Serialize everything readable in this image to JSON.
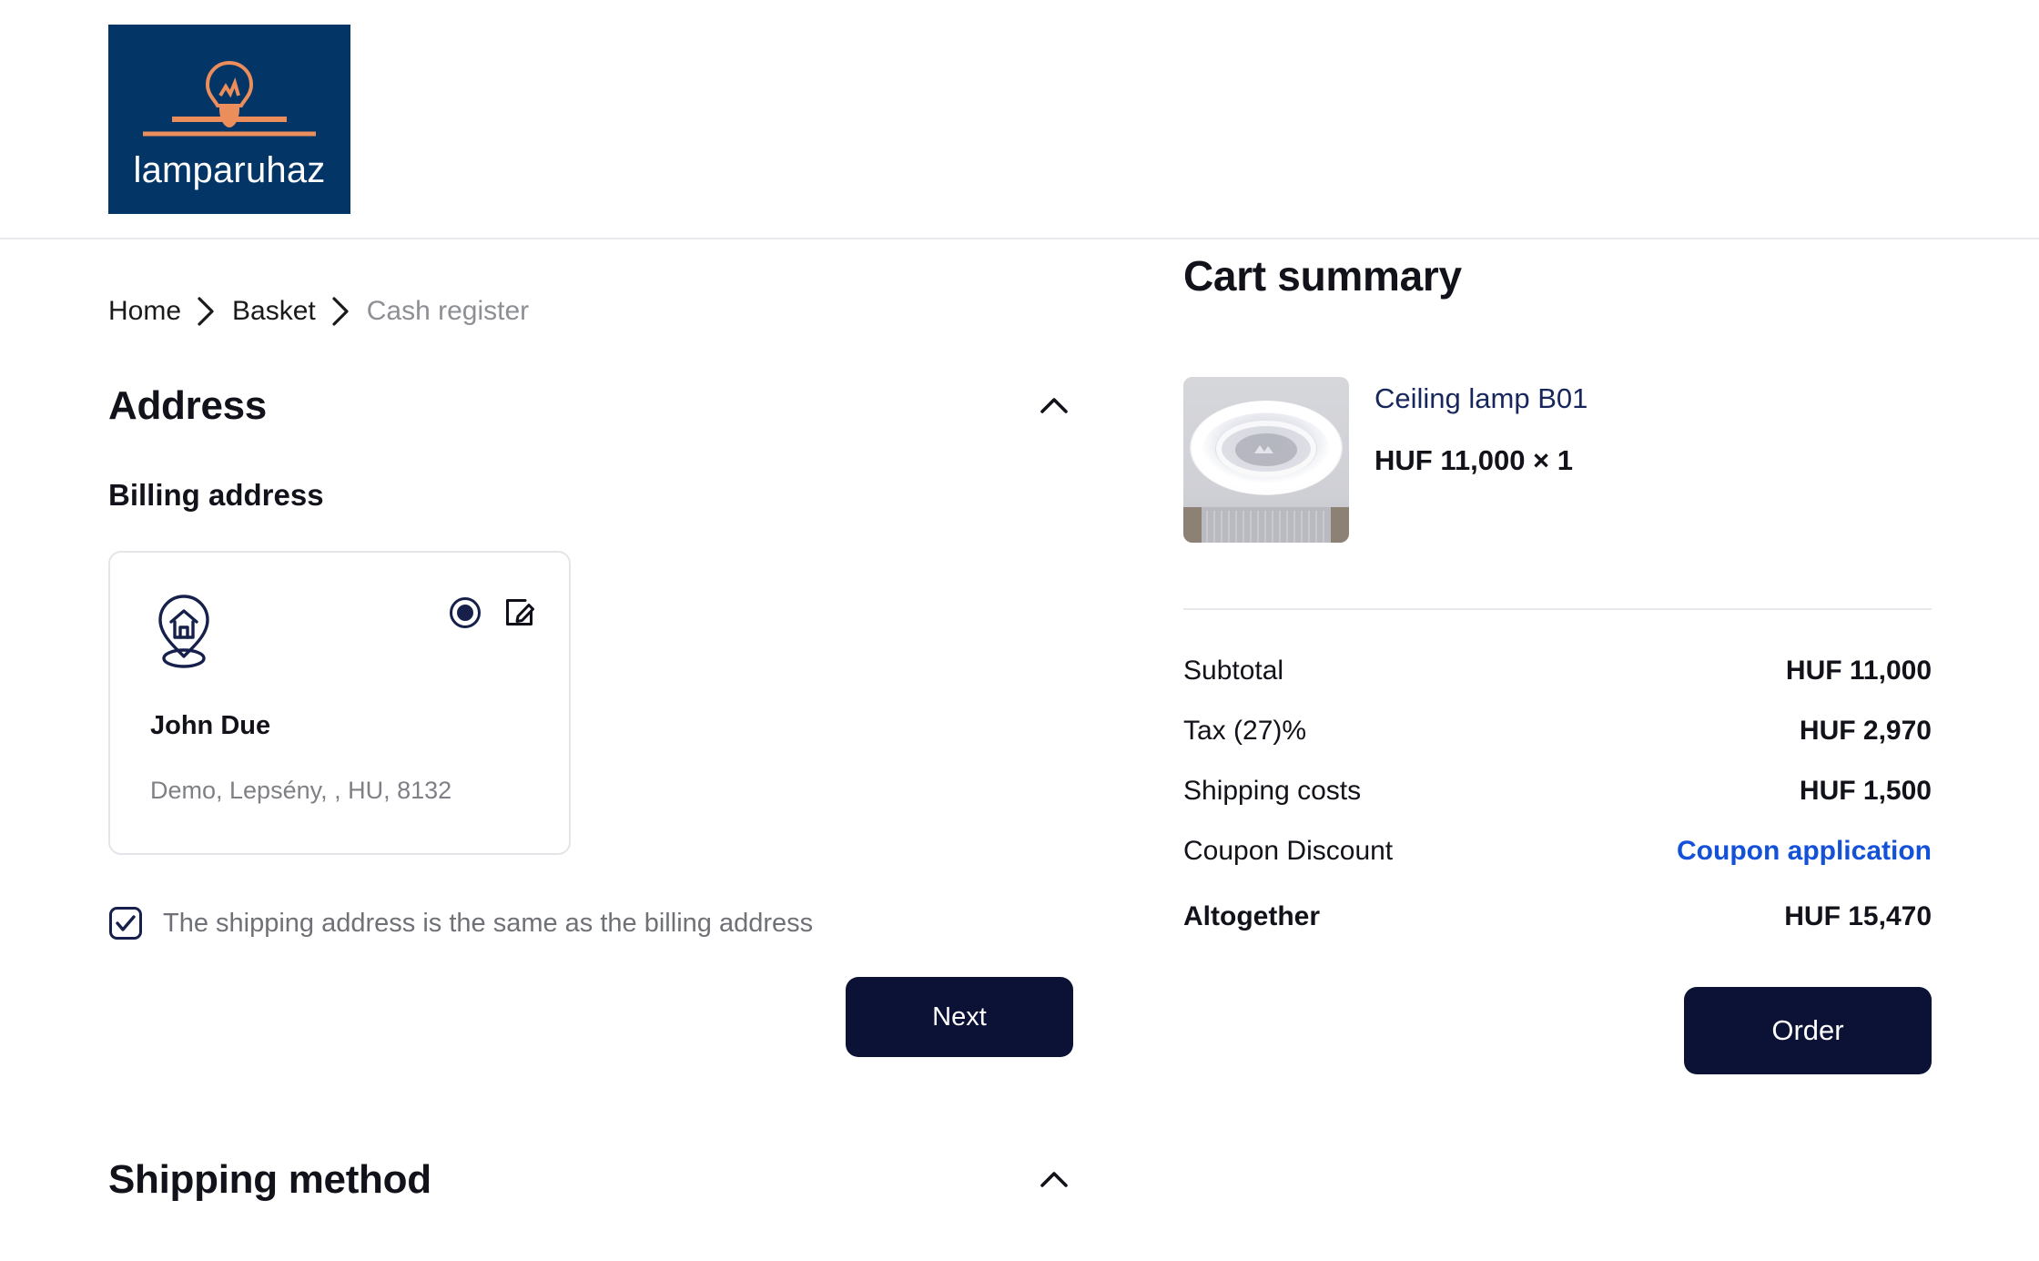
{
  "header": {
    "logo_word": "lamparuhaz",
    "logo_bg": "#033567",
    "logo_accent": "#ec8d5c"
  },
  "breadcrumb": {
    "items": [
      {
        "label": "Home",
        "muted": false
      },
      {
        "label": "Basket",
        "muted": false
      },
      {
        "label": "Cash register",
        "muted": true
      }
    ],
    "separator_icon": "chevron-right-icon"
  },
  "address_section": {
    "title": "Address",
    "collapse_icon": "chevron-up-icon",
    "billing_title": "Billing address",
    "card": {
      "pin_icon": "home-pin-icon",
      "radio_icon": "radio-selected-icon",
      "edit_icon": "edit-pencil-icon",
      "name": "John Due",
      "address_line": "Demo, Lepsény, , HU, 8132",
      "selected": true
    },
    "same_address_checkbox": {
      "label": "The shipping address is the same as the billing address",
      "checked": true,
      "icon": "checkbox-checked-icon"
    },
    "next_label": "Next"
  },
  "shipping_section": {
    "title": "Shipping method",
    "collapse_icon": "chevron-up-icon"
  },
  "cart": {
    "title": "Cart summary",
    "item": {
      "name": "Ceiling lamp B01",
      "price_line": "HUF 11,000 × 1",
      "thumbnail_icon": "ceiling-lamp-photo"
    },
    "totals": [
      {
        "label": "Subtotal",
        "value": "HUF 11,000",
        "link": false
      },
      {
        "label": "Tax (27)%",
        "value": "HUF 2,970",
        "link": false
      },
      {
        "label": "Shipping costs",
        "value": "HUF 1,500",
        "link": false
      },
      {
        "label": "Coupon Discount",
        "value": "Coupon application",
        "link": true
      }
    ],
    "grand_total": {
      "label": "Altogether",
      "value": "HUF 15,470"
    },
    "order_label": "Order",
    "link_color": "#1351d8",
    "button_color": "#0c1236"
  }
}
